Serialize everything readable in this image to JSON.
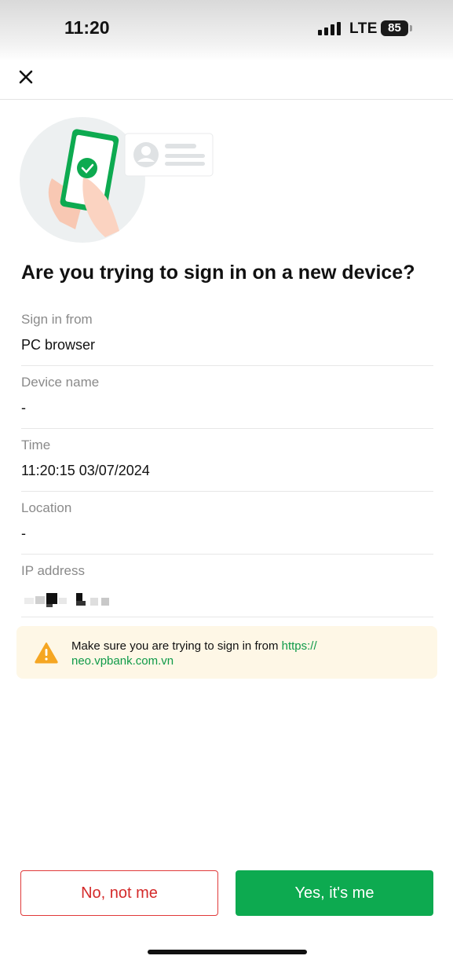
{
  "status_bar": {
    "time": "11:20",
    "network": "LTE",
    "battery": "85"
  },
  "header": {
    "close_icon": "close-icon"
  },
  "title": "Are you trying to sign in on a new device?",
  "info": [
    {
      "label": "Sign in from",
      "value": "PC browser"
    },
    {
      "label": "Device name",
      "value": "-"
    },
    {
      "label": "Time",
      "value": "11:20:15 03/07/2024"
    },
    {
      "label": "Location",
      "value": "-"
    },
    {
      "label": "IP address",
      "value": ""
    }
  ],
  "notice": {
    "icon": "warning-icon",
    "text": "Make sure you are trying to sign in from ",
    "link": "https://\nneo.vpbank.com.vn"
  },
  "buttons": {
    "no": "No, not me",
    "yes": "Yes, it's me"
  },
  "colors": {
    "accent_green": "#0daa50",
    "danger_red": "#d42a2a",
    "warning_orange": "#f5a623",
    "notice_bg": "#fef7e6"
  }
}
